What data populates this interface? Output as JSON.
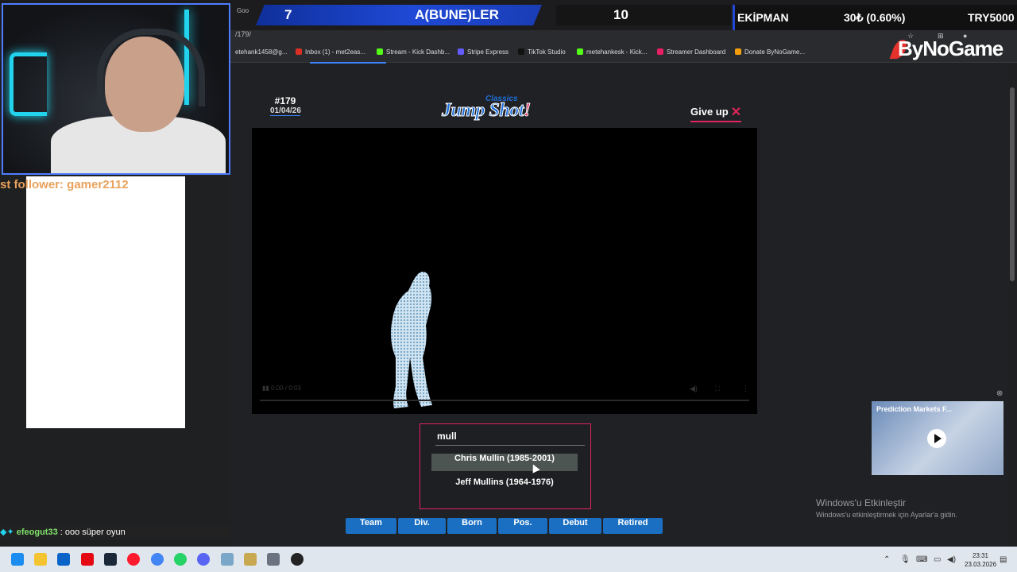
{
  "overlay": {
    "score_left": "7",
    "score_title": "A(BUNE)LER",
    "score_right": "10",
    "ekip_label": "EKİPMAN",
    "ekip_pct": "30₺ (0.60%)",
    "ekip_try": "TRY5000",
    "tiny_g": "Goo",
    "follower": "st follower: gamer2112",
    "chat_user": "efeogut33",
    "chat_msg": " : ooo süper oyun"
  },
  "browser": {
    "url": "/179/",
    "brand": "ByNoGame",
    "bookmarks": [
      "etehank1458@g...",
      "Inbox (1) - met2eas...",
      "Stream - Kick Dashb...",
      "Stripe Express",
      "TikTok Studio",
      "metehankesk - Kick...",
      "Streamer Dashboard",
      "Donate ByNoGame..."
    ]
  },
  "game": {
    "puzzle_number": "#179",
    "puzzle_date": "01/04/26",
    "logo_small": "Classics",
    "logo_main": "Jump Shot",
    "logo_bang": "!",
    "give_up": "Give up",
    "video_time": "0:00 / 0:03",
    "search_value": "mull",
    "suggestions": [
      "Chris Mullin (1985-2001)",
      "Jeff Mullins (1964-1976)"
    ],
    "hints": [
      "Team",
      "Div.",
      "Born",
      "Pos.",
      "Debut",
      "Retired"
    ]
  },
  "ad": {
    "title": "Prediction Markets F..."
  },
  "windows": {
    "activate_title": "Windows'u Etkinleştir",
    "activate_sub": "Windows'u etkinleştirmek için Ayarlar'a gidin.",
    "time": "23:31",
    "date": "23.03.2026"
  },
  "colors": {
    "accent_blue": "#1a6fc2",
    "accent_red": "#e0245e"
  }
}
